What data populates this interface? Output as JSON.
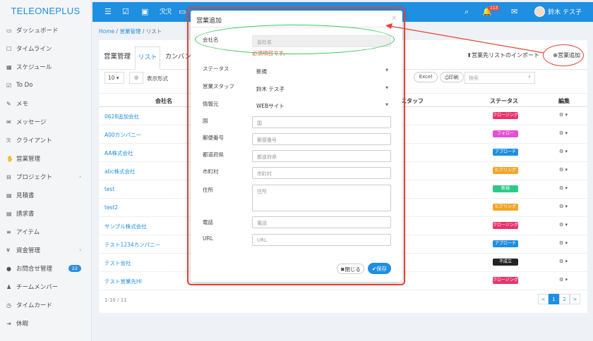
{
  "app": {
    "logo": "TELEONEPLUS"
  },
  "sidebar": {
    "items": [
      {
        "icon": "▭",
        "label": "ダッシュボード"
      },
      {
        "icon": "☐",
        "label": "タイムライン"
      },
      {
        "icon": "▦",
        "label": "スケジュール"
      },
      {
        "icon": "☑",
        "label": "To Do"
      },
      {
        "icon": "✎",
        "label": "メモ"
      },
      {
        "icon": "✉",
        "label": "メッセージ"
      },
      {
        "icon": "ℛ",
        "label": "クライアント"
      },
      {
        "icon": "✋",
        "label": "営業管理"
      },
      {
        "icon": "⊟",
        "label": "プロジェクト",
        "chevron": "›"
      },
      {
        "icon": "▤",
        "label": "見積書"
      },
      {
        "icon": "▤",
        "label": "請求書"
      },
      {
        "icon": "≡",
        "label": "アイテム"
      },
      {
        "icon": "¥",
        "label": "資金管理",
        "chevron": "›"
      },
      {
        "icon": "●",
        "label": "お問合せ管理",
        "badge": "22"
      },
      {
        "icon": "♟",
        "label": "チームメンバー"
      },
      {
        "icon": "◷",
        "label": "タイムカード"
      },
      {
        "icon": "⇥",
        "label": "休暇"
      }
    ]
  },
  "topbar": {
    "notif_count": "113",
    "user_name": "鈴木 テス子"
  },
  "breadcrumb": {
    "home": "Home",
    "sep": " / ",
    "section": "営業管理",
    "current": "リスト"
  },
  "page": {
    "title": "営業管理",
    "tab_list": "リスト",
    "tab_kanban": "カンバン",
    "import_label": "営業先リストのインポート",
    "add_label": "営業追加",
    "page_size": "10",
    "display_label": "表示形式",
    "excel_label": "Excel",
    "print_label": "印刷",
    "search_placeholder": "検索"
  },
  "table": {
    "headers": {
      "name": "会社名",
      "staff": "スタッフ",
      "status": "ステータス",
      "edit": "編集"
    },
    "rows": [
      {
        "name": "0628追加会社",
        "status": "クロージング",
        "color": "#e8336b"
      },
      {
        "name": "A00カンパニー",
        "status": "フォロー",
        "color": "#e44fd5"
      },
      {
        "name": "AA株式会社",
        "status": "アプローチ",
        "color": "#1e8fe1"
      },
      {
        "name": "abc株式会社",
        "status": "ヒアリング",
        "color": "#f0a72a"
      },
      {
        "name": "test",
        "status": "新規",
        "color": "#2ec98a"
      },
      {
        "name": "test2",
        "status": "ヒアリング",
        "color": "#f0a72a"
      },
      {
        "name": "サンプル株式会社",
        "status": "クロージング",
        "color": "#e8336b"
      },
      {
        "name": "テスト1234カンパニー",
        "status": "アプローチ",
        "color": "#1e8fe1"
      },
      {
        "name": "テスト会社",
        "status": "不成立",
        "color": "#222222"
      },
      {
        "name": "テスト営業先HI",
        "status": "クロージング",
        "color": "#e8336b"
      }
    ],
    "edit_glyph": "⚙ ▾",
    "pager_info": "1-10 / 11",
    "pager": [
      "<",
      "1",
      "2",
      ">"
    ]
  },
  "modal": {
    "title": "営業追加",
    "close_glyph": "×",
    "company_label": "会社名",
    "company_placeholder": "会社名",
    "required_error": "必須項目です。",
    "status_label": "ステータス",
    "status_value": "新規",
    "staff_label": "営業スタッフ",
    "staff_value": "鈴木 テス子",
    "source_label": "情報元",
    "source_value": "WEBサイト",
    "country_label": "国",
    "country_placeholder": "国",
    "zip_label": "郵便番号",
    "zip_placeholder": "郵便番号",
    "pref_label": "都道府県",
    "pref_placeholder": "都道府県",
    "city_label": "市町村",
    "city_placeholder": "市町村",
    "address_label": "住所",
    "address_placeholder": "住所",
    "phone_label": "電話",
    "phone_placeholder": "電話",
    "url_label": "URL",
    "url_placeholder": "URL",
    "btn_close": "✖閉じる",
    "btn_save": "✔保存"
  }
}
